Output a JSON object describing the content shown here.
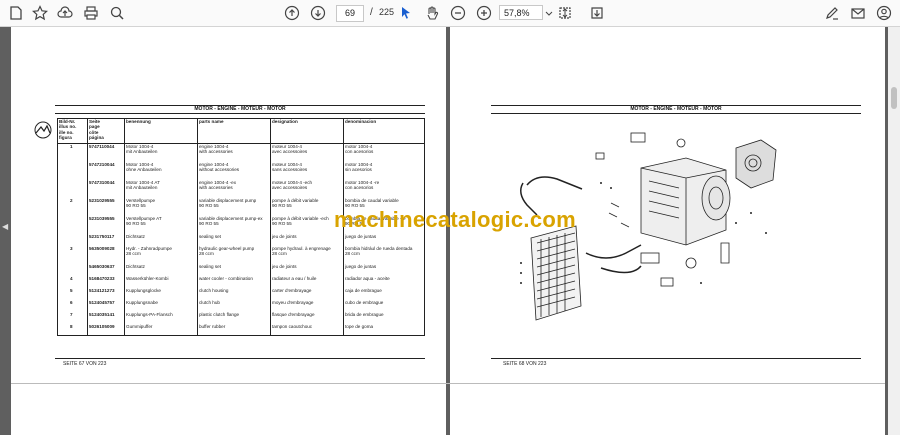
{
  "toolbar": {
    "page_current": "69",
    "page_sep": "/",
    "page_total": "225",
    "zoom": "57,8%"
  },
  "left_page": {
    "header": "MOTOR - ENGINE - MOTEUR - MOTOR",
    "columns": [
      "Bild-Nr.\nillus no.\nille no.\nfigura",
      "Seite\npage\ncôte\npágina",
      "benennung",
      "parts name",
      "designation",
      "denominacion"
    ],
    "rows": [
      {
        "fig": "1",
        "part": "5747110044",
        "de": "Motor 1004-4\nmit Anbauteilen",
        "en": "engine 1004-4\nwith accessories",
        "fr": "moteur 1004-4\navec accessoires",
        "es": "motor 1004-4\ncon acesorios"
      },
      {
        "fig": "",
        "part": "5747210044",
        "de": "Motor 1004-4\nohne Anbauteilen",
        "en": "engine 1004-4\nwithout accessories",
        "fr": "moteur 1004-4\nsans accessoires",
        "es": "motor 1004-4\nsin acesorios"
      },
      {
        "fig": "",
        "part": "5747310044",
        "de": "Motor 1004-4 AT\nmit Anbauteilen",
        "en": "engine 1004-4 -ex\nwith accessories",
        "fr": "moteur 1004-4 -ech\navec accessoires",
        "es": "motor 1004-4 -re\ncon acesorios"
      },
      {
        "fig": "2",
        "part": "5231029555",
        "de": "Verstellpumpe\n90 RO 55",
        "en": "variable displacement pump\n90 RO 55",
        "fr": "pompe à débit variable\n90 RO 55",
        "es": "bombia de caudal variable\n90 RO 55"
      },
      {
        "fig": "",
        "part": "5231039555",
        "de": "Verstellpumpe AT\n90 RO 55",
        "en": "variable displacement pump-ex\n90 RO 55",
        "fr": "pompe à débit variable -ech\n90 RO 55",
        "es": "bombia de caudal variable -re\n90 RO 55"
      },
      {
        "fig": "",
        "part": "5231750117",
        "de": "Dichtsatz",
        "en": "sealing set",
        "fr": "jeu de joints",
        "es": "juego de juntas"
      },
      {
        "fig": "3",
        "part": "5635009028",
        "de": "Hydr. - Zahnradpumpe\n28 ccm",
        "en": "hydraulic gear-wheel pump\n28 ccm",
        "fr": "pompe hydraul. à engrenage\n28 ccm",
        "es": "bombia hidrául de rueda dentada\n28 ccm"
      },
      {
        "fig": "",
        "part": "5465030637",
        "de": "Dichtsatz",
        "en": "sealing set",
        "fr": "jeu de joints",
        "es": "juego de juntas"
      },
      {
        "fig": "4",
        "part": "5168470233",
        "de": "Wasserkühler-Kombi",
        "en": "water cooler - combination",
        "fr": "radiateur a eau / huile",
        "es": "radiador aqua - aceite"
      },
      {
        "fig": "5",
        "part": "5124121273",
        "de": "Kupplungsglocke",
        "en": "clutch housing",
        "fr": "carter d'embrayage",
        "es": "caja de embrague"
      },
      {
        "fig": "6",
        "part": "5124045757",
        "de": "Kupplungsnabe",
        "en": "clutch hub",
        "fr": "moyeu d'embrayage",
        "es": "cubo de embrague"
      },
      {
        "fig": "7",
        "part": "5124035141",
        "de": "Kupplungs-PA-Flansch",
        "en": "plastic clutch flange",
        "fr": "flasque d'embrayage",
        "es": "brida de embrague"
      },
      {
        "fig": "8",
        "part": "5026105009",
        "de": "Gummipuffer",
        "en": "buffer rubber",
        "fr": "tampon caoutchouc",
        "es": "tope de goma"
      }
    ],
    "footer": "SEITE 67 VON 223"
  },
  "right_page": {
    "header": "MOTOR - ENGINE - MOTEUR - MOTOR",
    "footer": "SEITE 68 VON 223"
  },
  "watermark": "machinecatalogic.com",
  "icons": [
    "home-icon",
    "bookmark-star-icon",
    "upload-icon",
    "print-icon",
    "zoom-search-icon",
    "page-up-icon",
    "page-down-icon",
    "select-cursor-icon",
    "hand-tool-icon",
    "zoom-out-icon",
    "zoom-in-icon",
    "fit-page-icon",
    "download-icon",
    "sign-pen-icon",
    "mail-icon",
    "account-icon"
  ]
}
